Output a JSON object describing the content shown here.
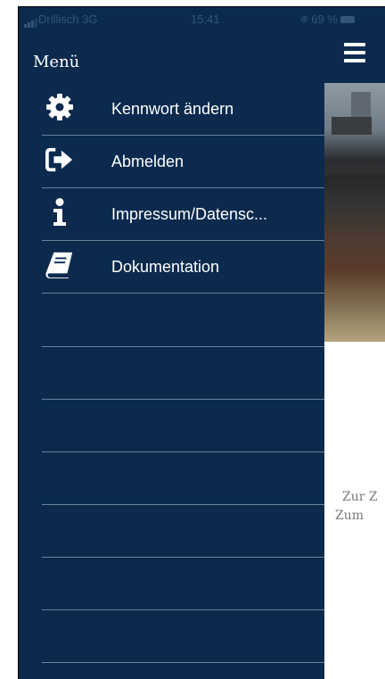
{
  "status_bar": {
    "carrier": "Drillisch  3G",
    "time": "15:41",
    "battery": "69 %"
  },
  "menu": {
    "title": "Menü",
    "items": [
      {
        "label": "Kennwort ändern",
        "icon": "gear-icon"
      },
      {
        "label": "Abmelden",
        "icon": "sign-out-icon"
      },
      {
        "label": "Impressum/Datensc...",
        "icon": "info-icon"
      },
      {
        "label": "Dokumentation",
        "icon": "book-icon"
      }
    ]
  },
  "content": {
    "line1": "Zur Z",
    "line2": "Zum"
  },
  "colors": {
    "drawer_bg": "#0b2a4e",
    "separator": "#6e819a",
    "text": "#ffffff"
  }
}
